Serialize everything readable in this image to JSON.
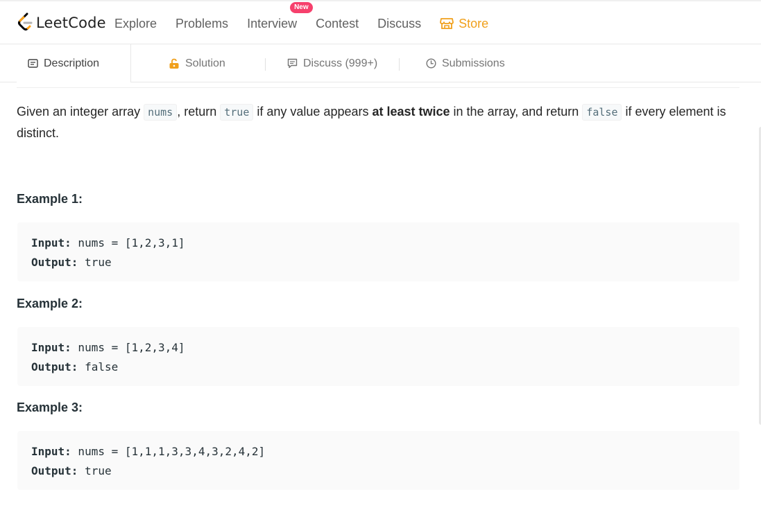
{
  "nav": {
    "logo_text": "LeetCode",
    "links": [
      "Explore",
      "Problems",
      "Interview",
      "Contest",
      "Discuss",
      "Store"
    ],
    "new_badge": "New"
  },
  "tabs": {
    "description": "Description",
    "solution": "Solution",
    "discuss": "Discuss (999+)",
    "submissions": "Submissions"
  },
  "problem": {
    "desc_1": "Given an integer array ",
    "code_nums": "nums",
    "desc_2": ", return ",
    "code_true": "true",
    "desc_3": " if any value appears ",
    "desc_bold": "at least twice",
    "desc_4": " in the array, and return ",
    "code_false": "false",
    "desc_5": " if every element is distinct."
  },
  "examples": [
    {
      "title": "Example 1:",
      "input_label": "Input:",
      "input_value": " nums = [1,2,3,1]",
      "output_label": "Output:",
      "output_value": " true"
    },
    {
      "title": "Example 2:",
      "input_label": "Input:",
      "input_value": " nums = [1,2,3,4]",
      "output_label": "Output:",
      "output_value": " false"
    },
    {
      "title": "Example 3:",
      "input_label": "Input:",
      "input_value": " nums = [1,1,1,3,3,4,3,2,4,2]",
      "output_label": "Output:",
      "output_value": " true"
    }
  ],
  "colors": {
    "store": "#f0a01c",
    "new_badge": "#f6406c",
    "logo_orange": "#ffa116"
  }
}
